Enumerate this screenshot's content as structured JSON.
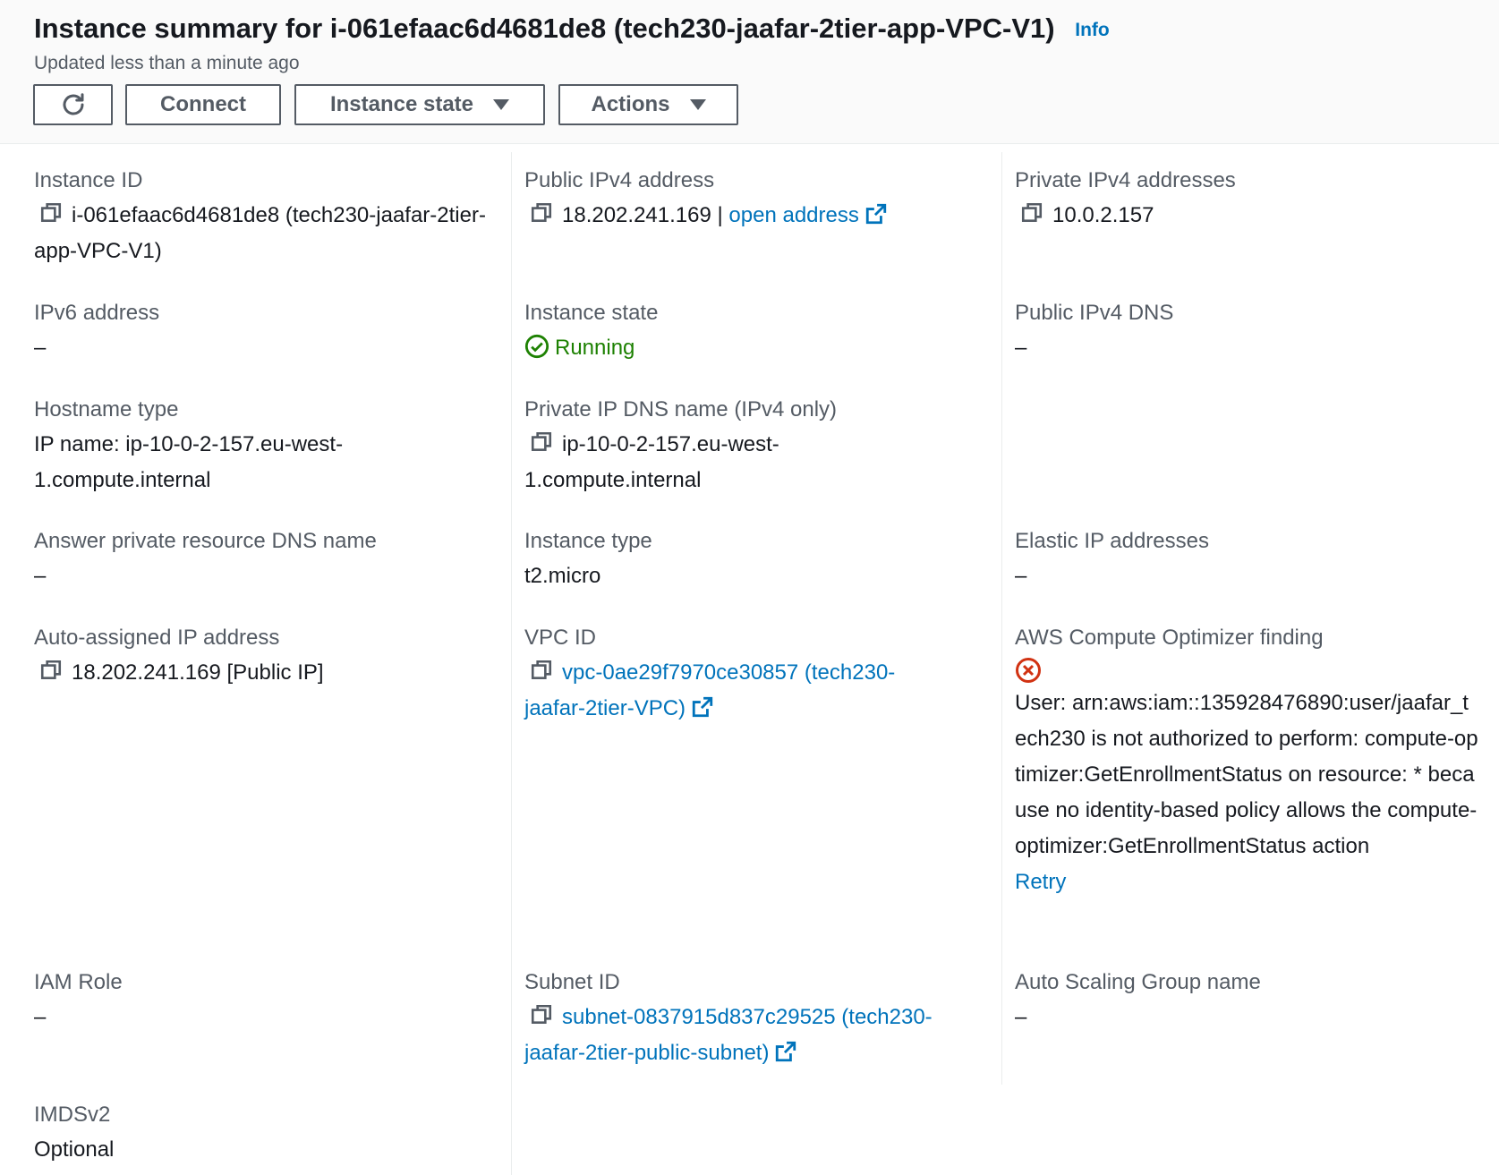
{
  "header": {
    "title": "Instance summary for i-061efaac6d4681de8 (tech230-jaafar-2tier-app-VPC-V1)",
    "info_label": "Info",
    "updated": "Updated less than a minute ago",
    "refresh_icon": "refresh-icon",
    "connect_label": "Connect",
    "instance_state_label": "Instance state",
    "actions_label": "Actions"
  },
  "fields": {
    "instance_id": {
      "label": "Instance ID",
      "value": "i-061efaac6d4681de8 (tech230-jaafar-2tier-app-VPC-V1)"
    },
    "public_ipv4": {
      "label": "Public IPv4 address",
      "value": "18.202.241.169 |",
      "link": "open address"
    },
    "private_ipv4": {
      "label": "Private IPv4 addresses",
      "value": "10.0.2.157"
    },
    "ipv6": {
      "label": "IPv6 address",
      "value": "–"
    },
    "instance_state": {
      "label": "Instance state",
      "value": "Running"
    },
    "public_dns": {
      "label": "Public IPv4 DNS",
      "value": "–"
    },
    "hostname_type": {
      "label": "Hostname type",
      "value": "IP name: ip-10-0-2-157.eu-west-1.compute.internal"
    },
    "private_dns": {
      "label": "Private IP DNS name (IPv4 only)",
      "value": "ip-10-0-2-157.eu-west-1.compute.internal"
    },
    "answer_dns": {
      "label": "Answer private resource DNS name",
      "value": "–"
    },
    "instance_type": {
      "label": "Instance type",
      "value": "t2.micro"
    },
    "elastic_ip": {
      "label": "Elastic IP addresses",
      "value": "–"
    },
    "auto_ip": {
      "label": "Auto-assigned IP address",
      "value": "18.202.241.169 [Public IP]"
    },
    "vpc_id": {
      "label": "VPC ID",
      "value": "vpc-0ae29f7970ce30857 (tech230-jaafar-2tier-VPC)"
    },
    "optimizer": {
      "label": "AWS Compute Optimizer finding",
      "error": "User: arn:aws:iam::135928476890:user/jaafar_tech230 is not authorized to perform: compute-optimizer:GetEnrollmentStatus on resource: * because no identity-based policy allows the compute-optimizer:GetEnrollmentStatus action",
      "retry": "Retry"
    },
    "iam_role": {
      "label": "IAM Role",
      "value": "–"
    },
    "subnet_id": {
      "label": "Subnet ID",
      "value": "subnet-0837915d837c29525 (tech230-jaafar-2tier-public-subnet)"
    },
    "asg_name": {
      "label": "Auto Scaling Group name",
      "value": "–"
    },
    "imdsv2": {
      "label": "IMDSv2",
      "value": "Optional"
    }
  },
  "colors": {
    "link": "#0073bb",
    "running": "#1d8102",
    "error": "#d13212",
    "label": "#545b64"
  }
}
